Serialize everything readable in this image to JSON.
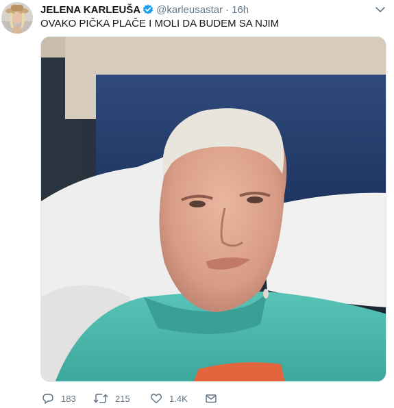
{
  "tweet": {
    "author_name": "JELENA KARLEUŠA",
    "handle": "@karleusastar",
    "separator": "·",
    "time": "16h",
    "text": "OVAKO PIČKA PLAČE I MOLI DA BUDEM SA NJIM",
    "verified": true
  },
  "actions": {
    "reply_count": "183",
    "retweet_count": "215",
    "like_count": "1.4K"
  },
  "colors": {
    "text_primary": "#14171a",
    "text_secondary": "#657786",
    "verified_blue": "#1da1f2",
    "border": "#e1e8ed"
  },
  "icons": [
    "verified-badge-icon",
    "caret-down-icon",
    "reply-icon",
    "retweet-icon",
    "like-icon",
    "direct-message-icon"
  ]
}
